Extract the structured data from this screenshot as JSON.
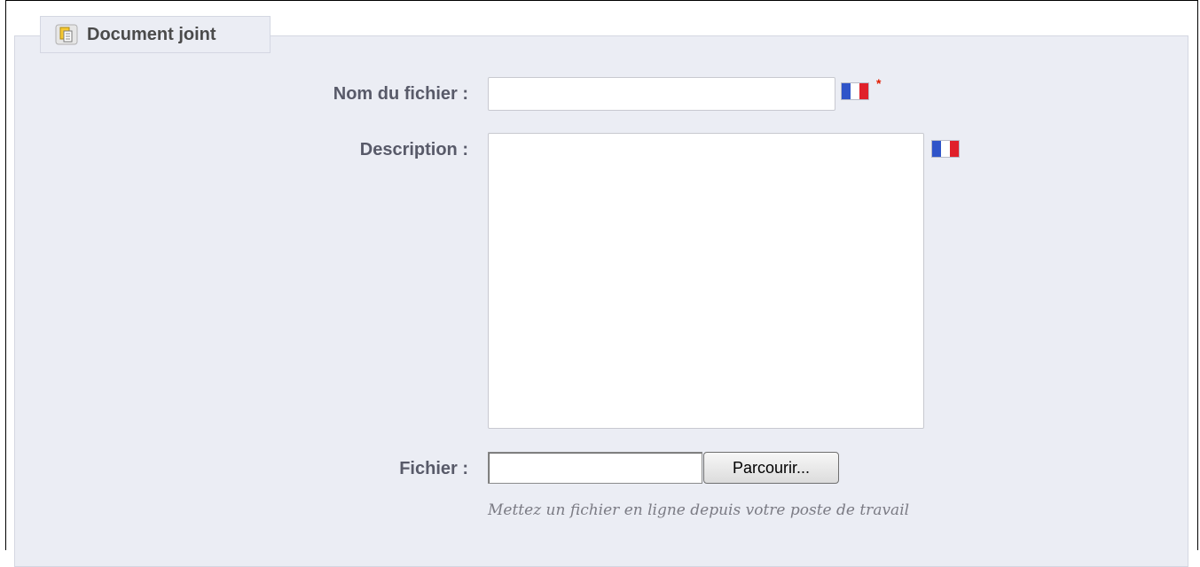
{
  "fieldset": {
    "legend_title": "Document joint",
    "legend_icon": "document-icon"
  },
  "fields": {
    "filename": {
      "label": "Nom du fichier :",
      "value": "",
      "required_mark": "*",
      "lang_flag": "fr-flag-icon"
    },
    "description": {
      "label": "Description :",
      "value": "",
      "lang_flag": "fr-flag-icon"
    },
    "file": {
      "label": "Fichier :",
      "value": "",
      "browse_label": "Parcourir...",
      "hint": "Mettez un fichier en ligne depuis votre poste de travail"
    }
  },
  "colors": {
    "flag_blue": "#2f54c9",
    "flag_white": "#ffffff",
    "flag_red": "#e0202a",
    "required": "#e21c00"
  }
}
